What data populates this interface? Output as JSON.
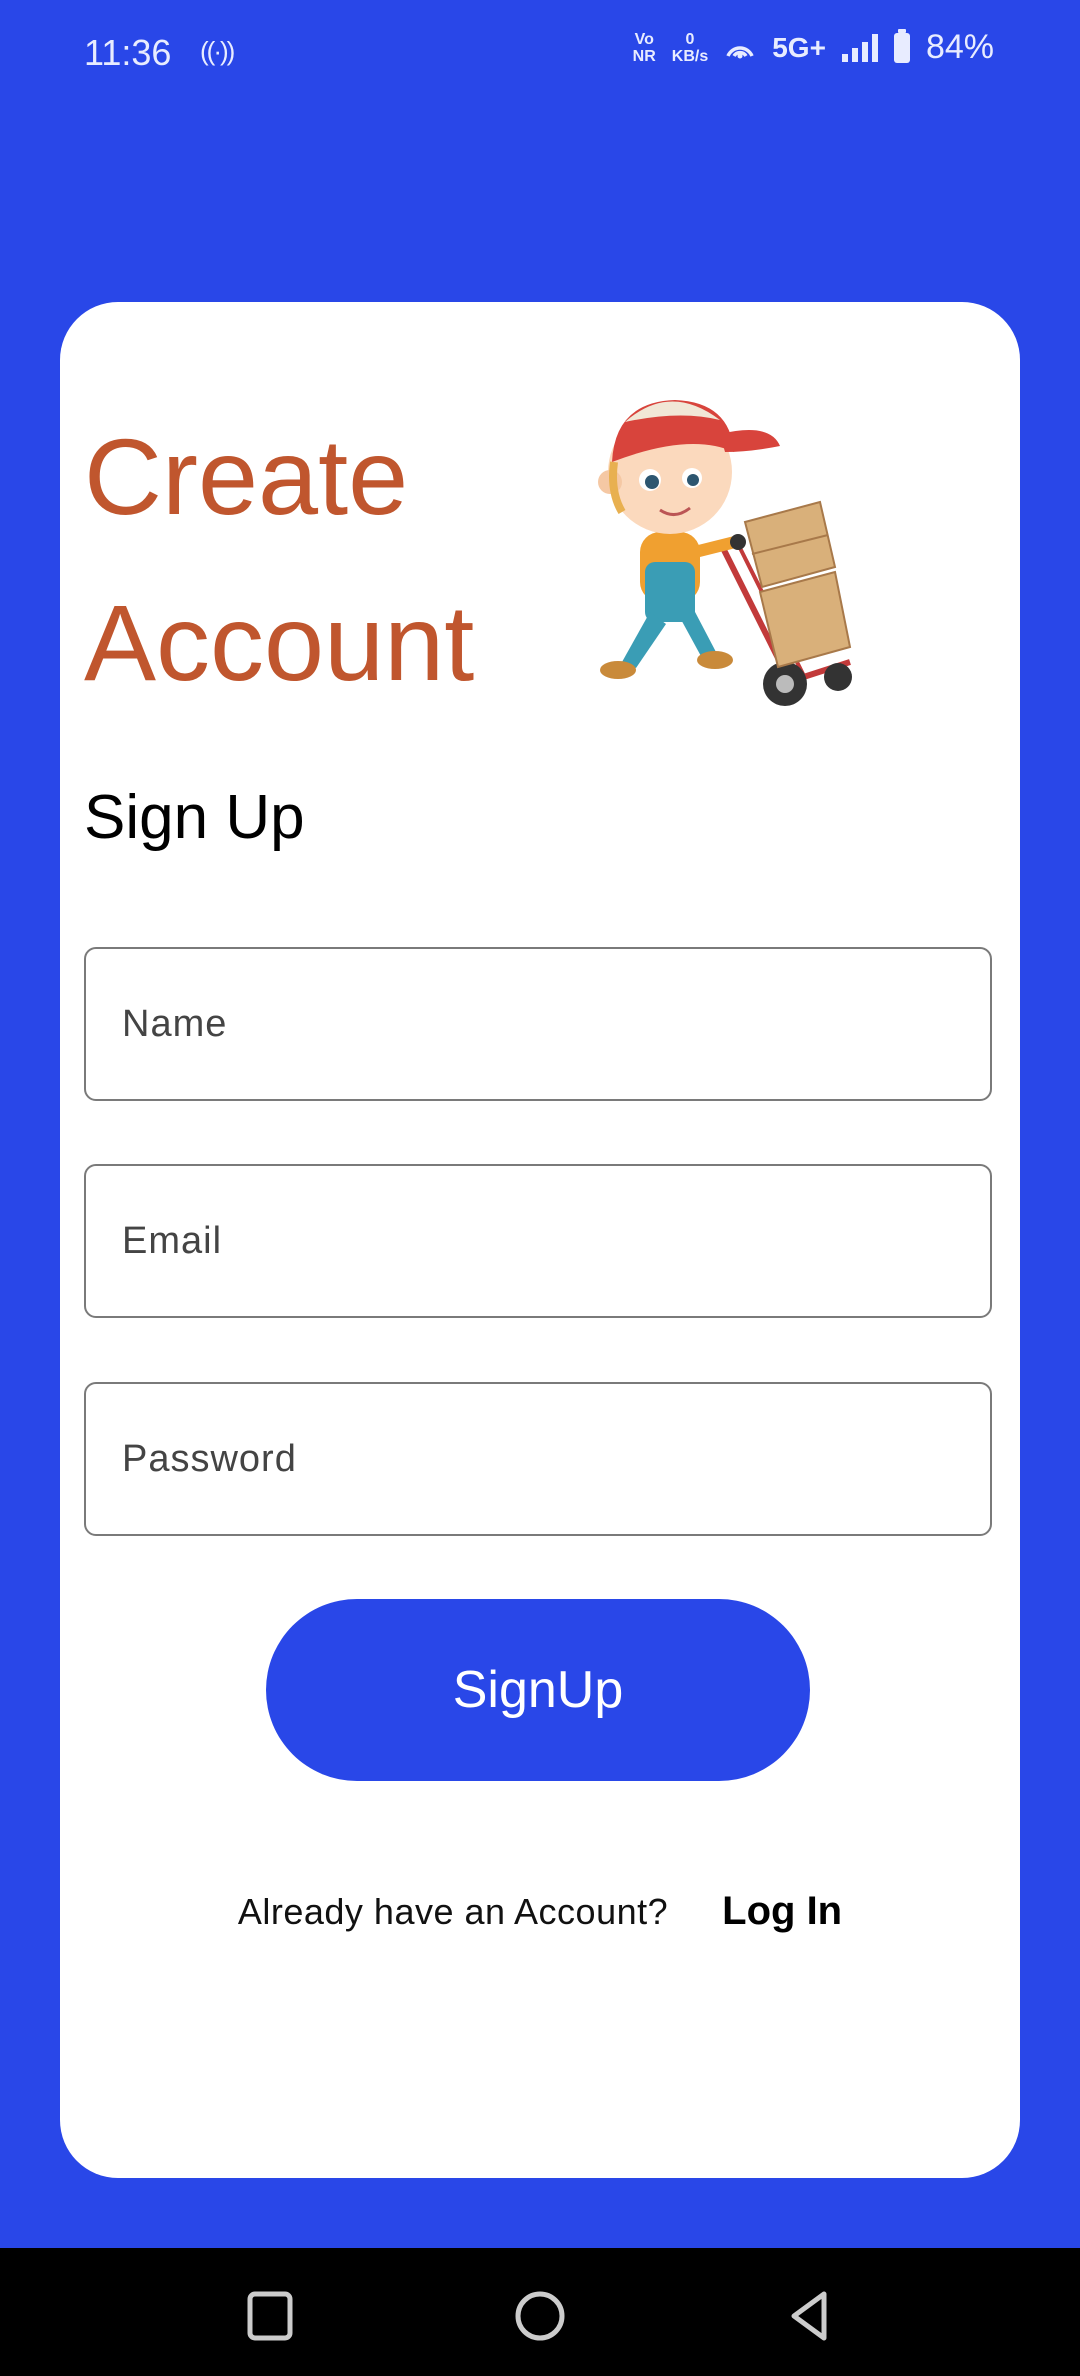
{
  "status_bar": {
    "time": "11:36",
    "hotspot_icon": "((·))",
    "volte_top": "Vo",
    "volte_bottom": "NR",
    "speed_value": "0",
    "speed_unit": "KB/s",
    "network": "5G+",
    "battery": "84%"
  },
  "card": {
    "title_line1": "Create",
    "title_line2": "Account",
    "heading": "Sign Up",
    "name_placeholder": "Name",
    "email_placeholder": "Email",
    "password_placeholder": "Password",
    "signup_button": "SignUp",
    "login_prompt": "Already have an Account?",
    "login_link": "Log In"
  },
  "colors": {
    "background": "#2947E8",
    "title": "#C0562E",
    "button": "#2947E8"
  }
}
